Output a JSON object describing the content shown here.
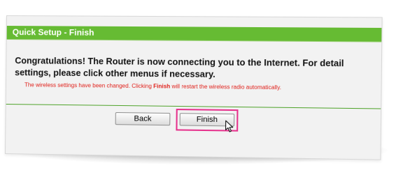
{
  "header": {
    "title": "Quick Setup - Finish"
  },
  "message": "Congratulations! The Router is now connecting you to the Internet. For detail settings, please click other menus if necessary.",
  "notice": {
    "before": "The wireless settings have been changed. Clicking ",
    "emphasis": "Finish",
    "after": " will restart the wireless radio automatically."
  },
  "buttons": {
    "back_label": "Back",
    "finish_label": "Finish"
  },
  "colors": {
    "header_green": "#66bb33",
    "notice_red": "#e0201a",
    "highlight_pink": "#e6318c"
  },
  "icons": {
    "cursor": "mouse-pointer-icon"
  }
}
